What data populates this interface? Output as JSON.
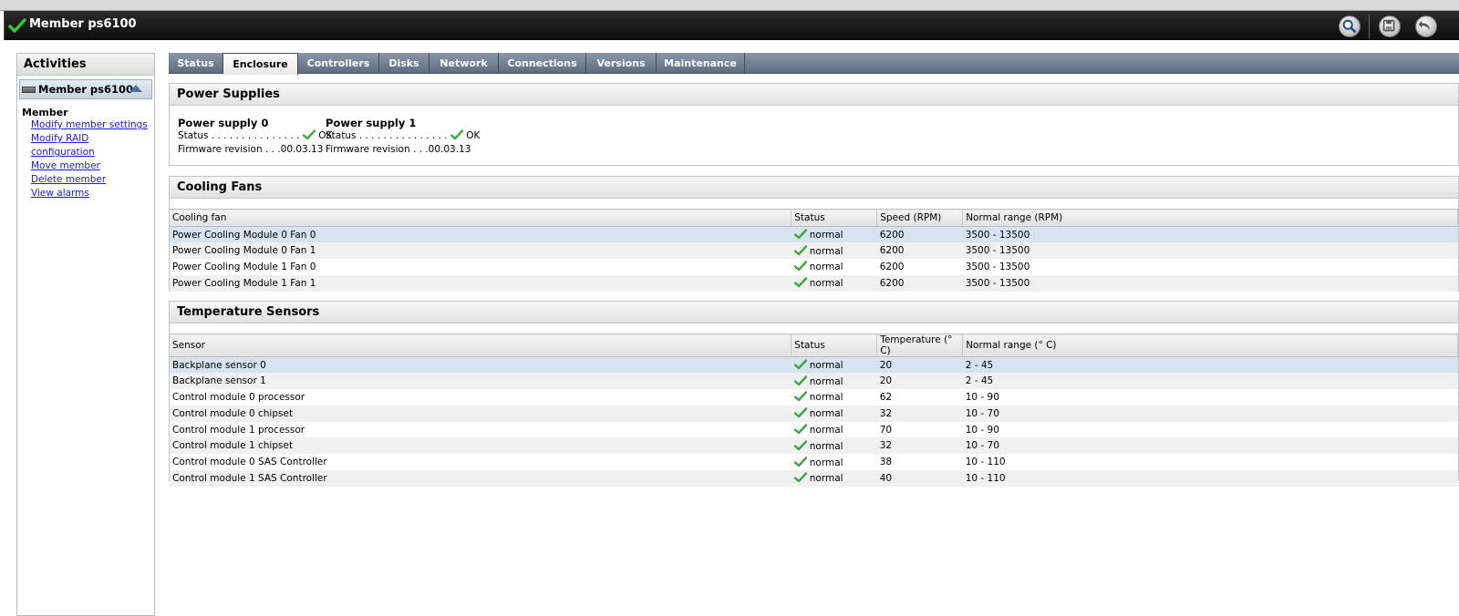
{
  "window": {
    "title": "Member ps6100"
  },
  "activities": {
    "header": "Activities",
    "member_label": "Member ps6100",
    "section": "Member",
    "links": [
      "Modify member settings",
      "Modify RAID configuration",
      "Move member",
      "Delete member",
      "View alarms"
    ]
  },
  "tabs": [
    "Status",
    "Enclosure",
    "Controllers",
    "Disks",
    "Network",
    "Connections",
    "Versions",
    "Maintenance"
  ],
  "active_tab": "Enclosure",
  "power_supplies": {
    "title": "Power Supplies",
    "items": [
      {
        "name": "Power supply 0",
        "status_label": "Status . . . . . . . . . . . . . . .",
        "status": "OK",
        "fw_label": "Firmware revision . . .",
        "fw": "00.03.13"
      },
      {
        "name": "Power supply 1",
        "status_label": "Status . . . . . . . . . . . . . . .",
        "status": "OK",
        "fw_label": "Firmware revision . . .",
        "fw": "00.03.13"
      }
    ]
  },
  "cooling_fans": {
    "title": "Cooling Fans",
    "columns": [
      "Cooling fan",
      "Status",
      "Speed (RPM)",
      "Normal range (RPM)"
    ],
    "rows": [
      [
        "Power Cooling Module 0 Fan 0",
        "normal",
        "6200",
        "3500 - 13500"
      ],
      [
        "Power Cooling Module 0 Fan 1",
        "normal",
        "6200",
        "3500 - 13500"
      ],
      [
        "Power Cooling Module 1 Fan 0",
        "normal",
        "6200",
        "3500 - 13500"
      ],
      [
        "Power Cooling Module 1 Fan 1",
        "normal",
        "6200",
        "3500 - 13500"
      ]
    ]
  },
  "temperature_sensors": {
    "title": "Temperature Sensors",
    "columns": [
      "Sensor",
      "Status",
      "Temperature (° C)",
      "Normal range (° C)"
    ],
    "rows": [
      [
        "Backplane sensor 0",
        "normal",
        "20",
        "2 - 45"
      ],
      [
        "Backplane sensor 1",
        "normal",
        "20",
        "2 - 45"
      ],
      [
        "Control module 0 processor",
        "normal",
        "62",
        "10 - 90"
      ],
      [
        "Control module 0 chipset",
        "normal",
        "32",
        "10 - 70"
      ],
      [
        "Control module 1 processor",
        "normal",
        "70",
        "10 - 90"
      ],
      [
        "Control module 1 chipset",
        "normal",
        "32",
        "10 - 70"
      ],
      [
        "Control module 0 SAS Controller",
        "normal",
        "38",
        "10 - 110"
      ],
      [
        "Control module 1 SAS Controller",
        "normal",
        "40",
        "10 - 110"
      ]
    ]
  },
  "colors": {
    "ok_check": "#3aa83a",
    "link": "#1a1ad8",
    "selected_row": "#d6e3f1"
  },
  "icons": {
    "title": "check-icon",
    "search": "search-icon",
    "save": "save-icon",
    "back": "back-icon"
  }
}
